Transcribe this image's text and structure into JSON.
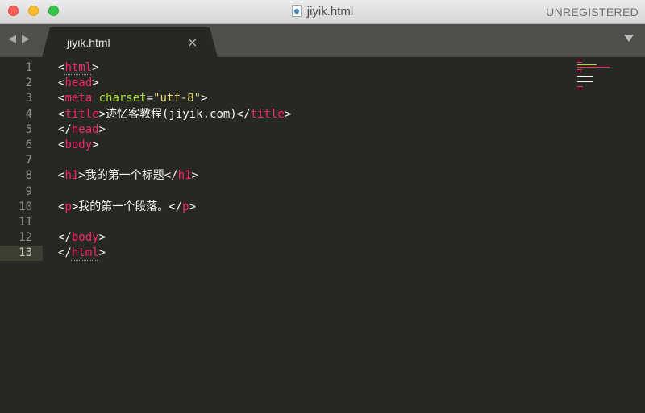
{
  "window": {
    "title": "jiyik.html",
    "license_label": "UNREGISTERED"
  },
  "tabs": [
    {
      "label": "jiyik.html",
      "close_glyph": "×"
    }
  ],
  "nav": {
    "back_glyph": "◀",
    "forward_glyph": "▶"
  },
  "colors": {
    "background": "#272822",
    "tag": "#f92672",
    "attribute": "#a6e22e",
    "string": "#e6db74",
    "text": "#f8f8f2",
    "gutter": "#8f908a"
  },
  "editor": {
    "current_line": 13,
    "lines": [
      {
        "n": "1",
        "p": [
          "<",
          "html",
          ">"
        ]
      },
      {
        "n": "2",
        "p": [
          "<",
          "head",
          ">"
        ]
      },
      {
        "n": "3",
        "p": [
          "<",
          "meta",
          " ",
          "charset",
          "=",
          "\"utf-8\"",
          ">"
        ]
      },
      {
        "n": "4",
        "p": [
          "<",
          "title",
          ">迹忆客教程(jiyik.com)</",
          "title",
          ">"
        ]
      },
      {
        "n": "5",
        "p": [
          "</",
          "head",
          ">"
        ]
      },
      {
        "n": "6",
        "p": [
          "<",
          "body",
          ">"
        ]
      },
      {
        "n": "7",
        "p": []
      },
      {
        "n": "8",
        "p": [
          "<",
          "h1",
          ">我的第一个标题</",
          "h1",
          ">"
        ]
      },
      {
        "n": "9",
        "p": []
      },
      {
        "n": "10",
        "p": [
          "<",
          "p",
          ">我的第一个段落。</",
          "p",
          ">"
        ]
      },
      {
        "n": "11",
        "p": []
      },
      {
        "n": "12",
        "p": [
          "</",
          "body",
          ">"
        ]
      },
      {
        "n": "13",
        "p": [
          "</",
          "html",
          ">"
        ]
      }
    ]
  }
}
